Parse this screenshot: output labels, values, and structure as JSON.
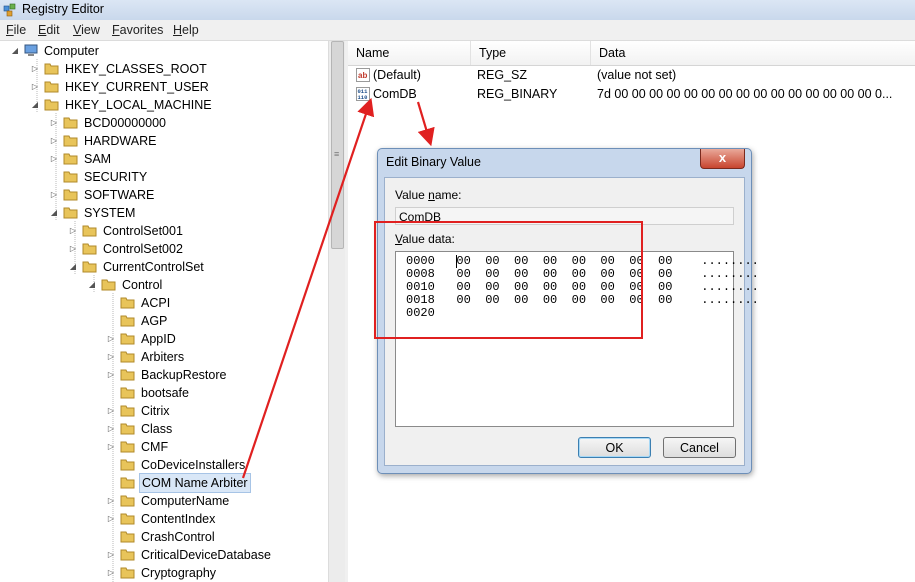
{
  "window": {
    "title": "Registry Editor"
  },
  "menu": {
    "file_first": "F",
    "file_rest": "ile",
    "edit_first": "E",
    "edit_rest": "dit",
    "view_first": "V",
    "view_rest": "iew",
    "favorites_first": "F",
    "favorites_rest": "avorites",
    "help_first": "H",
    "help_rest": "elp"
  },
  "tree": {
    "items": [
      {
        "label": "Computer"
      },
      {
        "label": "HKEY_CLASSES_ROOT"
      },
      {
        "label": "HKEY_CURRENT_USER"
      },
      {
        "label": "HKEY_LOCAL_MACHINE"
      },
      {
        "label": "BCD00000000"
      },
      {
        "label": "HARDWARE"
      },
      {
        "label": "SAM"
      },
      {
        "label": "SECURITY"
      },
      {
        "label": "SOFTWARE"
      },
      {
        "label": "SYSTEM"
      },
      {
        "label": "ControlSet001"
      },
      {
        "label": "ControlSet002"
      },
      {
        "label": "CurrentControlSet"
      },
      {
        "label": "Control"
      },
      {
        "label": "ACPI"
      },
      {
        "label": "AGP"
      },
      {
        "label": "AppID"
      },
      {
        "label": "Arbiters"
      },
      {
        "label": "BackupRestore"
      },
      {
        "label": "bootsafe"
      },
      {
        "label": "Citrix"
      },
      {
        "label": "Class"
      },
      {
        "label": "CMF"
      },
      {
        "label": "CoDeviceInstallers"
      },
      {
        "label": "COM Name Arbiter"
      },
      {
        "label": "ComputerName"
      },
      {
        "label": "ContentIndex"
      },
      {
        "label": "CrashControl"
      },
      {
        "label": "CriticalDeviceDatabase"
      },
      {
        "label": "Cryptography"
      }
    ]
  },
  "list": {
    "headers": {
      "name": "Name",
      "type": "Type",
      "data": "Data"
    },
    "rows": [
      {
        "icon": "string-value-icon",
        "name": "(Default)",
        "type": "REG_SZ",
        "data": "(value not set)"
      },
      {
        "icon": "binary-value-icon",
        "name": "ComDB",
        "type": "REG_BINARY",
        "data": "7d 00 00 00 00 00 00 00 00 00 00 00 00 00 00 00 0..."
      }
    ]
  },
  "dialog": {
    "title": "Edit Binary Value",
    "close_label": "x",
    "value_name_label_pre": "Value ",
    "value_name_label_ul": "n",
    "value_name_label_post": "ame:",
    "value_name": "ComDB",
    "value_data_label_ul": "V",
    "value_data_label_post": "alue data:",
    "hex_lines": [
      "0000   00  00  00  00  00  00  00  00    ........",
      "0008   00  00  00  00  00  00  00  00    ........",
      "0010   00  00  00  00  00  00  00  00    ........",
      "0018   00  00  00  00  00  00  00  00    ........",
      "0020"
    ],
    "ok_label": "OK",
    "cancel_label": "Cancel"
  },
  "colors": {
    "annotation": "#e02020",
    "selection": "#d9e7f7",
    "folder": "#e8c45a"
  }
}
